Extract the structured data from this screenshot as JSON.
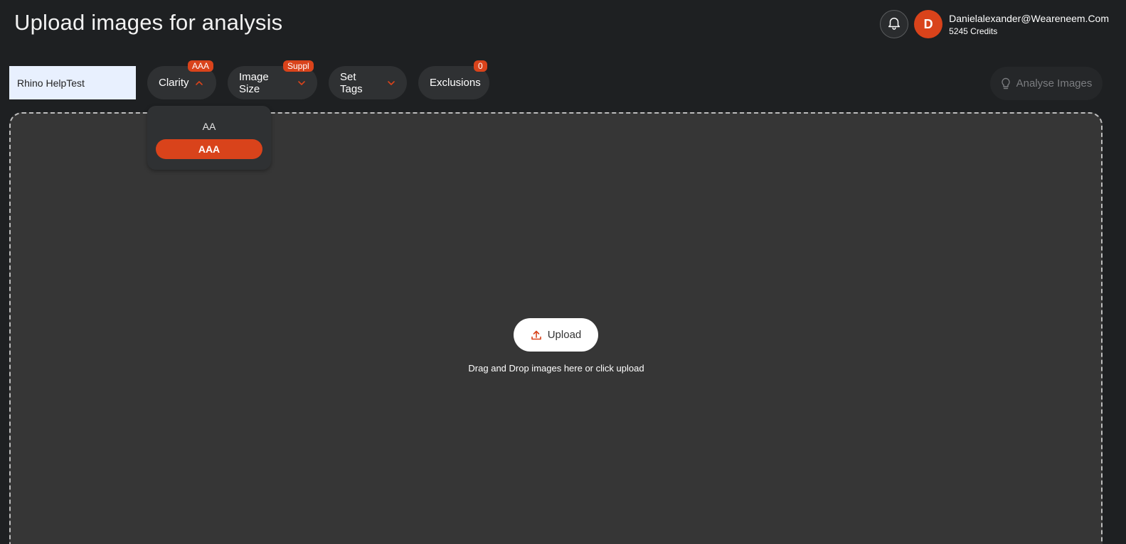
{
  "page": {
    "title": "Upload images for analysis"
  },
  "user": {
    "avatar_initial": "D",
    "email": "Danielalexander@Weareneem.Com",
    "credits": "5245 Credits"
  },
  "toolbar": {
    "project_name_value": "Rhino HelpTest",
    "clarity": {
      "label": "Clarity",
      "badge": "AAA"
    },
    "image_size": {
      "label": "Image Size",
      "badge": "Suppl"
    },
    "set_tags": {
      "label": "Set Tags"
    },
    "exclusions": {
      "label": "Exclusions",
      "badge": "0"
    },
    "analyse_label": "Analyse Images"
  },
  "clarity_dropdown": {
    "options": [
      "AA",
      "AAA"
    ],
    "selected": "AAA"
  },
  "upload": {
    "button_label": "Upload",
    "hint": "Drag and Drop images here or click upload"
  },
  "colors": {
    "accent": "#d9431b",
    "background": "#1e2022",
    "panel": "#363636",
    "pill": "#2f3133"
  },
  "icons": {
    "bell": "bell-icon",
    "chevron_up": "chevron-up-icon",
    "chevron_down": "chevron-down-icon",
    "bulb": "lightbulb-icon",
    "upload": "upload-icon"
  }
}
